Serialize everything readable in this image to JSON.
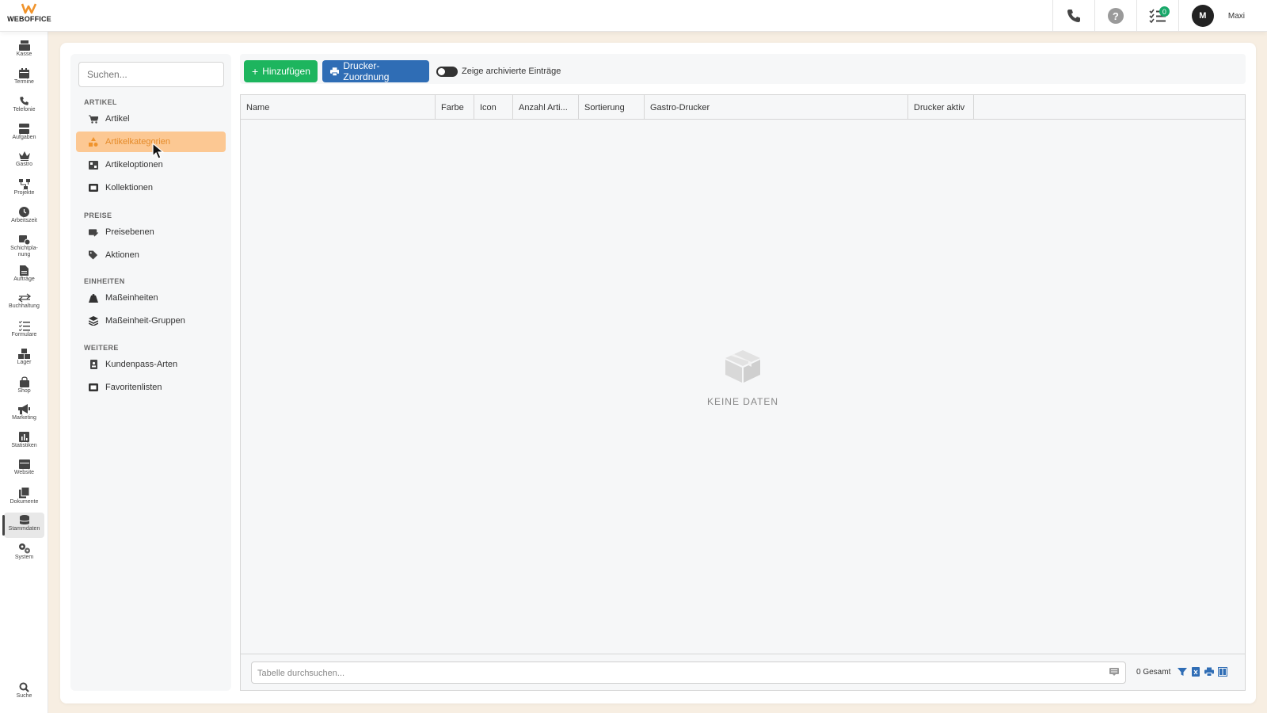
{
  "brand": {
    "name": "WEBOFFICE",
    "accent": "#f0932b"
  },
  "user": {
    "initial": "M",
    "name": "Maxi"
  },
  "tasks_badge": "0",
  "help_label": "?",
  "nav": [
    {
      "label": "Kasse",
      "icon": "register-icon"
    },
    {
      "label": "Termine",
      "icon": "calendar-icon"
    },
    {
      "label": "Telefonie",
      "icon": "phone-icon"
    },
    {
      "label": "Aufgaben",
      "icon": "tasks-icon"
    },
    {
      "label": "Gastro",
      "icon": "crown-icon"
    },
    {
      "label": "Projekte",
      "icon": "projects-icon"
    },
    {
      "label": "Arbeitszeit",
      "icon": "clock-icon"
    },
    {
      "label": "Schichtpla-nung",
      "icon": "shift-icon"
    },
    {
      "label": "Aufträge",
      "icon": "order-icon"
    },
    {
      "label": "Buchhaltung",
      "icon": "exchange-icon"
    },
    {
      "label": "Formulare",
      "icon": "form-icon"
    },
    {
      "label": "Lager",
      "icon": "boxes-icon"
    },
    {
      "label": "Shop",
      "icon": "bag-icon"
    },
    {
      "label": "Marketing",
      "icon": "megaphone-icon"
    },
    {
      "label": "Statistiken",
      "icon": "chart-icon"
    },
    {
      "label": "Website",
      "icon": "website-icon"
    },
    {
      "label": "Dokumente",
      "icon": "documents-icon"
    },
    {
      "label": "Stammdaten",
      "icon": "database-icon"
    },
    {
      "label": "System",
      "icon": "gears-icon"
    }
  ],
  "nav_search": "Suche",
  "subnav": {
    "search_placeholder": "Suchen...",
    "sections": [
      {
        "title": "ARTIKEL",
        "items": [
          "Artikel",
          "Artikelkategorien",
          "Artikeloptionen",
          "Kollektionen"
        ]
      },
      {
        "title": "PREISE",
        "items": [
          "Preisebenen",
          "Aktionen"
        ]
      },
      {
        "title": "EINHEITEN",
        "items": [
          "Maßeinheiten",
          "Maßeinheit-Gruppen"
        ]
      },
      {
        "title": "WEITERE",
        "items": [
          "Kundenpass-Arten",
          "Favoritenlisten"
        ]
      }
    ],
    "active_item": "Artikelkategorien",
    "active_bg": "#fcc893"
  },
  "toolbar": {
    "add_label": "Hinzufügen",
    "printer_label": "Drucker-Zuordnung",
    "archived_label": "Zeige archivierte Einträge",
    "archived_on": false
  },
  "table": {
    "columns": [
      "Name",
      "Farbe",
      "Icon",
      "Anzahl Arti...",
      "Sortierung",
      "Gastro-Drucker",
      "Drucker aktiv"
    ],
    "rows": [],
    "empty_text": "KEINE DATEN",
    "search_placeholder": "Tabelle durchsuchen...",
    "total": "0 Gesamt"
  }
}
